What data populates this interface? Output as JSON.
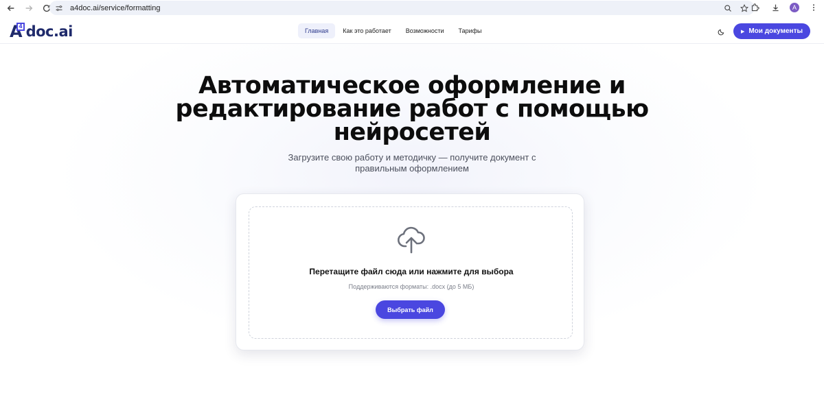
{
  "browser": {
    "url": "a4doc.ai/service/formatting",
    "avatar_letter": "A"
  },
  "logo": {
    "a_letter": "A",
    "box_digit": "4",
    "text": "doc.ai"
  },
  "nav": {
    "items": [
      {
        "label": "Главная",
        "active": true
      },
      {
        "label": "Как это работает",
        "active": false
      },
      {
        "label": "Возможности",
        "active": false
      },
      {
        "label": "Тарифы",
        "active": false
      }
    ]
  },
  "header": {
    "docs_button": "Мои документы"
  },
  "hero": {
    "title": "Автоматическое оформление и редактирование работ с помощью нейросетей",
    "subtitle": "Загрузите свою работу и методичку — получите документ с правильным оформлением"
  },
  "upload": {
    "title": "Перетащите файл сюда или нажмите для выбора",
    "formats": "Поддерживаются форматы: .docx (до 5 МБ)",
    "button": "Выбрать файл"
  },
  "colors": {
    "accent": "#4a47e0",
    "brand_dark": "#1f2a6b"
  }
}
